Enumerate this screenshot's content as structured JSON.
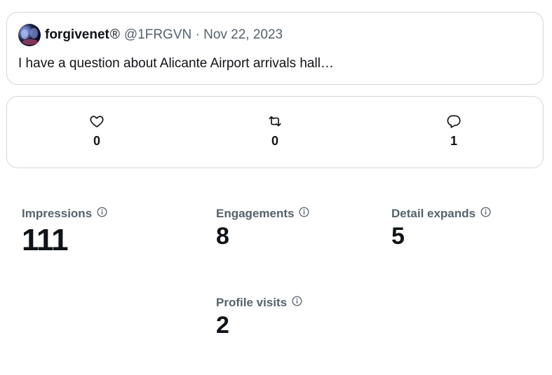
{
  "tweet": {
    "display_name": "forgivenet",
    "reg_mark": "®",
    "handle_date": "@1FRGVN · Nov 22, 2023",
    "text": "I have a question about Alicante Airport arrivals hall…"
  },
  "actions": {
    "likes": "0",
    "reposts": "0",
    "replies": "1"
  },
  "metrics": {
    "impressions": {
      "label": "Impressions",
      "value": "111"
    },
    "engagements": {
      "label": "Engagements",
      "value": "8"
    },
    "detail_expands": {
      "label": "Detail expands",
      "value": "5"
    },
    "profile_visits": {
      "label": "Profile visits",
      "value": "2"
    }
  },
  "icons": {
    "like": "heart-icon",
    "repost": "repost-icon",
    "reply": "reply-icon",
    "info": "info-icon"
  },
  "colors": {
    "text_primary": "#0f1419",
    "text_secondary": "#536471",
    "border": "#cfd9de"
  }
}
